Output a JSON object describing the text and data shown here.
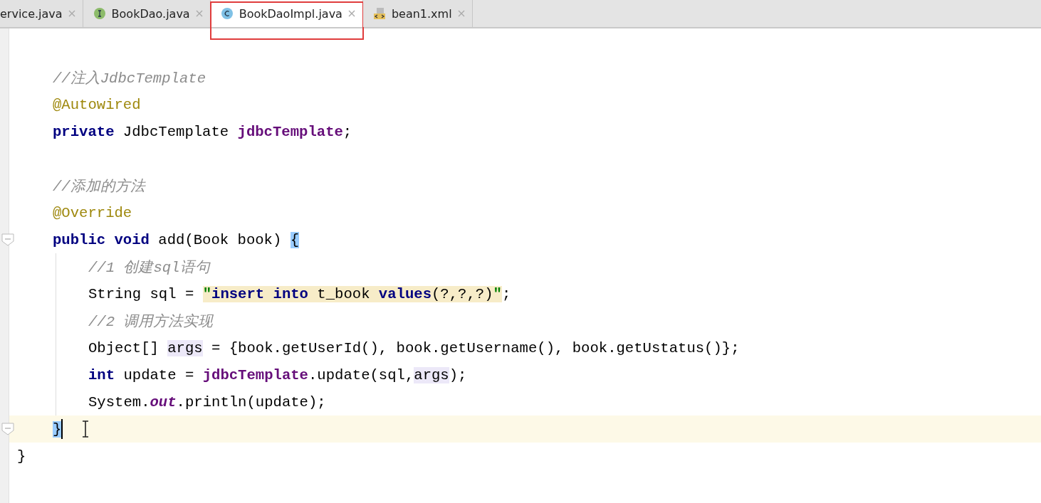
{
  "tabs": [
    {
      "label": "ervice.java",
      "kind": "none",
      "selected": false,
      "highlighted": false
    },
    {
      "label": "BookDao.java",
      "kind": "interface",
      "selected": false,
      "highlighted": false
    },
    {
      "label": "BookDaoImpl.java",
      "kind": "class",
      "selected": true,
      "highlighted": true
    },
    {
      "label": "bean1.xml",
      "kind": "xml",
      "selected": false,
      "highlighted": false
    }
  ],
  "editor": {
    "lines": [
      {
        "kind": "blank"
      },
      {
        "kind": "code",
        "tokens": [
          {
            "text": "//注入JdbcTemplate",
            "kind": "comment"
          }
        ]
      },
      {
        "kind": "code",
        "tokens": [
          {
            "text": "@Autowired",
            "kind": "annotation"
          }
        ]
      },
      {
        "kind": "code",
        "tokens": [
          {
            "text": "private",
            "kind": "keyword"
          },
          {
            "text": " JdbcTemplate ",
            "kind": "plain"
          },
          {
            "text": "jdbcTemplate",
            "kind": "field"
          },
          {
            "text": ";",
            "kind": "plain"
          }
        ]
      },
      {
        "kind": "blank"
      },
      {
        "kind": "code",
        "tokens": [
          {
            "text": "//添加的方法",
            "kind": "comment"
          }
        ]
      },
      {
        "kind": "code",
        "tokens": [
          {
            "text": "@Override",
            "kind": "annotation"
          }
        ]
      },
      {
        "kind": "code",
        "fold": true,
        "tokens": [
          {
            "text": "public void",
            "kind": "keyword"
          },
          {
            "text": " add(Book book) ",
            "kind": "plain"
          },
          {
            "text": "{",
            "kind": "brace_match"
          }
        ],
        "children": [
          {
            "kind": "code",
            "tokens": [
              {
                "text": "//1 创建sql语句",
                "kind": "comment"
              }
            ]
          },
          {
            "kind": "code",
            "tokens": [
              {
                "text": "String sql = ",
                "kind": "plain"
              },
              {
                "text": "\"",
                "kind": "string"
              },
              {
                "text": "insert into",
                "kind": "sql_keyword"
              },
              {
                "text": " t_book ",
                "kind": "sql_plain"
              },
              {
                "text": "values",
                "kind": "sql_keyword"
              },
              {
                "text": "(?,?,?)",
                "kind": "sql_plain"
              },
              {
                "text": "\"",
                "kind": "string"
              },
              {
                "text": ";",
                "kind": "plain"
              }
            ]
          },
          {
            "kind": "code",
            "tokens": [
              {
                "text": "//2 调用方法实现",
                "kind": "comment"
              }
            ]
          },
          {
            "kind": "code",
            "tokens": [
              {
                "text": "Object[] ",
                "kind": "plain"
              },
              {
                "text": "args",
                "kind": "usage"
              },
              {
                "text": " = {book.getUserId(), book.getUsername(), book.getUstatus()};",
                "kind": "plain"
              }
            ]
          },
          {
            "kind": "code",
            "tokens": [
              {
                "text": "int",
                "kind": "keyword"
              },
              {
                "text": " update = ",
                "kind": "plain"
              },
              {
                "text": "jdbcTemplate",
                "kind": "field"
              },
              {
                "text": ".update(sql,",
                "kind": "plain"
              },
              {
                "text": "args",
                "kind": "usage"
              },
              {
                "text": ");",
                "kind": "plain"
              }
            ]
          },
          {
            "kind": "code",
            "tokens": [
              {
                "text": "System.",
                "kind": "plain"
              },
              {
                "text": "out",
                "kind": "static"
              },
              {
                "text": ".println(update);",
                "kind": "plain"
              }
            ]
          }
        ],
        "closing": {
          "current": true,
          "caret": true,
          "tokens": [
            {
              "text": "}",
              "kind": "brace_match"
            }
          ]
        }
      }
    ],
    "end": "}"
  }
}
